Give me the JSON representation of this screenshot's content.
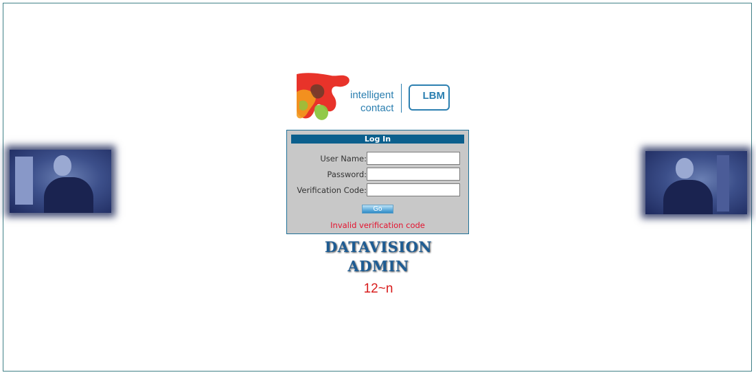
{
  "logo": {
    "line1": "intelligent",
    "line2": "contact",
    "brand": "LBM",
    "mark_colors": [
      "#e8332a",
      "#f39a1e",
      "#8cc63f",
      "#6b3b2a"
    ],
    "brand_color": "#2b7fb0"
  },
  "login": {
    "header": "Log In",
    "username_label": "User Name:",
    "username_value": "",
    "password_label": "Password:",
    "password_value": "",
    "verification_label": "Verification Code:",
    "verification_value": "",
    "go_label": "Go",
    "error": "Invalid verification code"
  },
  "app": {
    "title_line1": "DATAVISION",
    "title_line2": "ADMIN",
    "captcha": "12~n"
  },
  "colors": {
    "header_bg": "#0b5f8d",
    "panel_bg": "#c8c8c8",
    "error": "#e4122e",
    "title": "#1e5c93",
    "captcha": "#d81b1b"
  },
  "images": {
    "left": "photo-woman-at-desk",
    "right": "photo-man-on-phone"
  }
}
